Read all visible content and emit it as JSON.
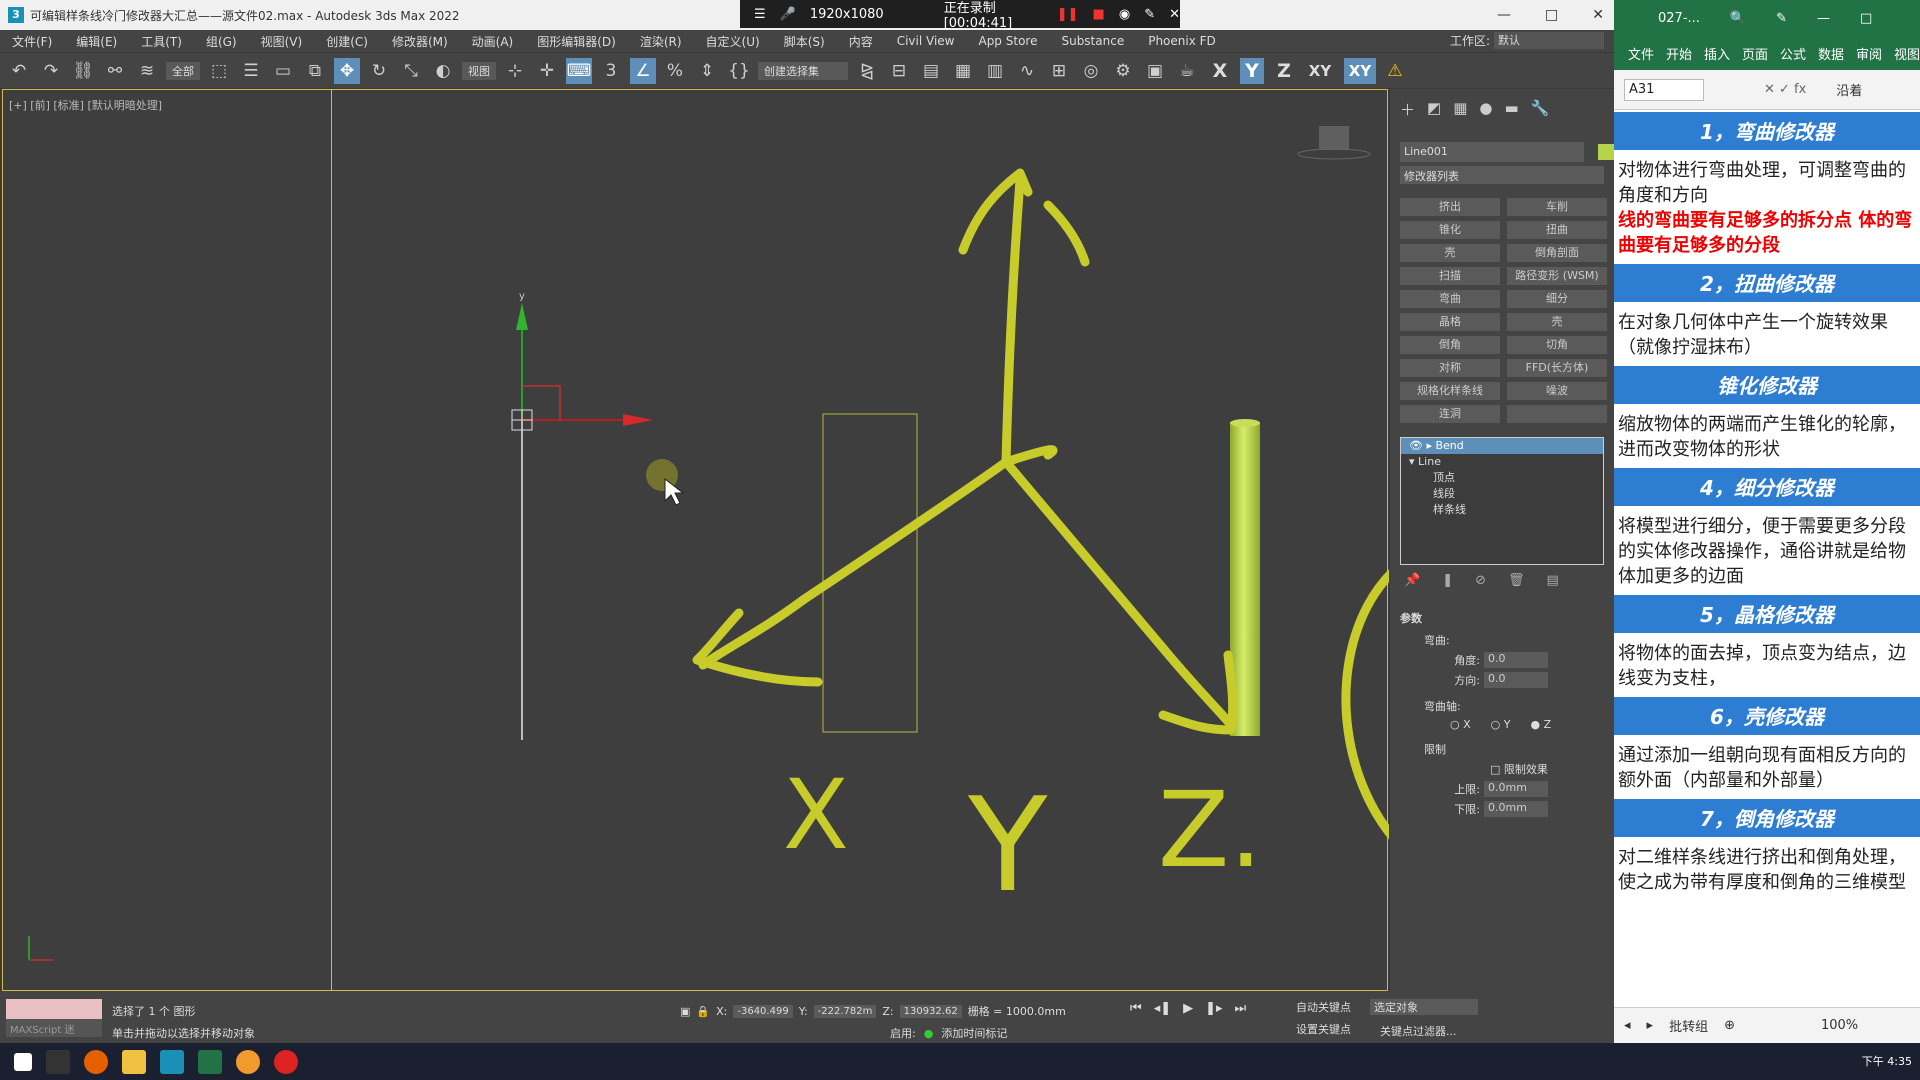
{
  "window": {
    "title": "可编辑样条线冷门修改器大汇总——源文件02.max - Autodesk 3ds Max 2022",
    "controls": [
      "—",
      "□",
      "✕"
    ]
  },
  "recorder": {
    "resolution": "1920x1080",
    "status": "正在录制 [00:04:41]"
  },
  "menubar": {
    "items": [
      "文件(F)",
      "编辑(E)",
      "工具(T)",
      "组(G)",
      "视图(V)",
      "创建(C)",
      "修改器(M)",
      "动画(A)",
      "图形编辑器(D)",
      "渲染(R)",
      "自定义(U)",
      "脚本(S)",
      "内容",
      "Civil View",
      "App Store",
      "Substance",
      "Phoenix FD"
    ],
    "workspace_label": "工作区:",
    "workspace_value": "默认"
  },
  "toolbar": {
    "filter": "全部",
    "ref_coord": "视图",
    "selection_set": "创建选择集",
    "axes": [
      "X",
      "Y",
      "Z",
      "XY",
      "XY"
    ]
  },
  "viewport": {
    "label": "[+] [前] [标准] [默认明暗处理]",
    "handwriting": [
      "X",
      "Y",
      "Z."
    ]
  },
  "command_panel": {
    "object_name": "Line001",
    "modifier_list": "修改器列表",
    "buttons": [
      "挤出",
      "车削",
      "锥化",
      "扭曲",
      "壳",
      "倒角剖面",
      "扫描",
      "路径变形 (WSM)",
      "弯曲",
      "细分",
      "晶格",
      "壳",
      "倒角",
      "切角",
      "对称",
      "FFD(长方体)",
      "规格化样条线",
      "噪波",
      "连洞",
      ""
    ],
    "stack": {
      "bend": "Bend",
      "line": "Line",
      "subs": [
        "顶点",
        "线段",
        "样条线"
      ]
    },
    "params": {
      "header": "参数",
      "bend_group": "弯曲:",
      "angle_label": "角度:",
      "angle_value": "0.0",
      "direction_label": "方向:",
      "direction_value": "0.0",
      "axis_group": "弯曲轴:",
      "axis_options": [
        "X",
        "Y",
        "Z"
      ],
      "limit_group": "限制",
      "limit_effect": "限制效果",
      "upper_label": "上限:",
      "upper_value": "0.0mm",
      "lower_label": "下限:",
      "lower_value": "0.0mm"
    }
  },
  "statusbar": {
    "maxscript": "MAXScript 迷",
    "line1": "选择了 1 个 图形",
    "line2": "单击并拖动以选择并移动对象",
    "x_label": "X:",
    "x_value": "-3640.499",
    "y_label": "Y:",
    "y_value": "-222.782m",
    "z_label": "Z:",
    "z_value": "130932.62",
    "grid": "栅格 = 1000.0mm",
    "enable": "启用:",
    "add_time_tag": "添加时间标记",
    "auto_key": "自动关键点",
    "set_key": "设置关键点",
    "key_select": "选定对象",
    "key_filter": "关键点过滤器..."
  },
  "taskbar": {
    "clock": "下午 4:35"
  },
  "excel": {
    "title": "027-...",
    "tabs": [
      "文件",
      "开始",
      "插入",
      "页面",
      "公式",
      "数据",
      "审阅",
      "视图"
    ],
    "cell_ref": "A31",
    "right": "沿着",
    "sections": [
      {
        "title": "1，弯曲修改器",
        "body": "对物体进行弯曲处理，可调整弯曲的角度和方向",
        "red": "线的弯曲要有足够多的拆分点 体的弯曲要有足够多的分段"
      },
      {
        "title": "2，扭曲修改器",
        "body": "在对象几何体中产生一个旋转效果（就像拧湿抹布）",
        "red": ""
      },
      {
        "title": "锥化修改器",
        "body": "缩放物体的两端而产生锥化的轮廓，进而改变物体的形状",
        "red": ""
      },
      {
        "title": "4，细分修改器",
        "body": "将模型进行细分，便于需要更多分段的实体修改器操作，通俗讲就是给物体加更多的边面",
        "red": ""
      },
      {
        "title": "5，晶格修改器",
        "body": "将物体的面去掉，顶点变为结点，边线变为支柱，",
        "red": ""
      },
      {
        "title": "6，壳修改器",
        "body": "通过添加一组朝向现有面相反方向的额外面（内部量和外部量）",
        "red": ""
      },
      {
        "title": "7，倒角修改器",
        "body": "对二维样条线进行挤出和倒角处理，使之成为带有厚度和倒角的三维模型",
        "red": ""
      }
    ],
    "footer": "批转组",
    "zoom": "100%"
  },
  "colors": {
    "annotation": "#c8cc2a",
    "accent": "#5d8fb8",
    "excel_header": "#2d7dd2",
    "excel_green": "#217346"
  }
}
